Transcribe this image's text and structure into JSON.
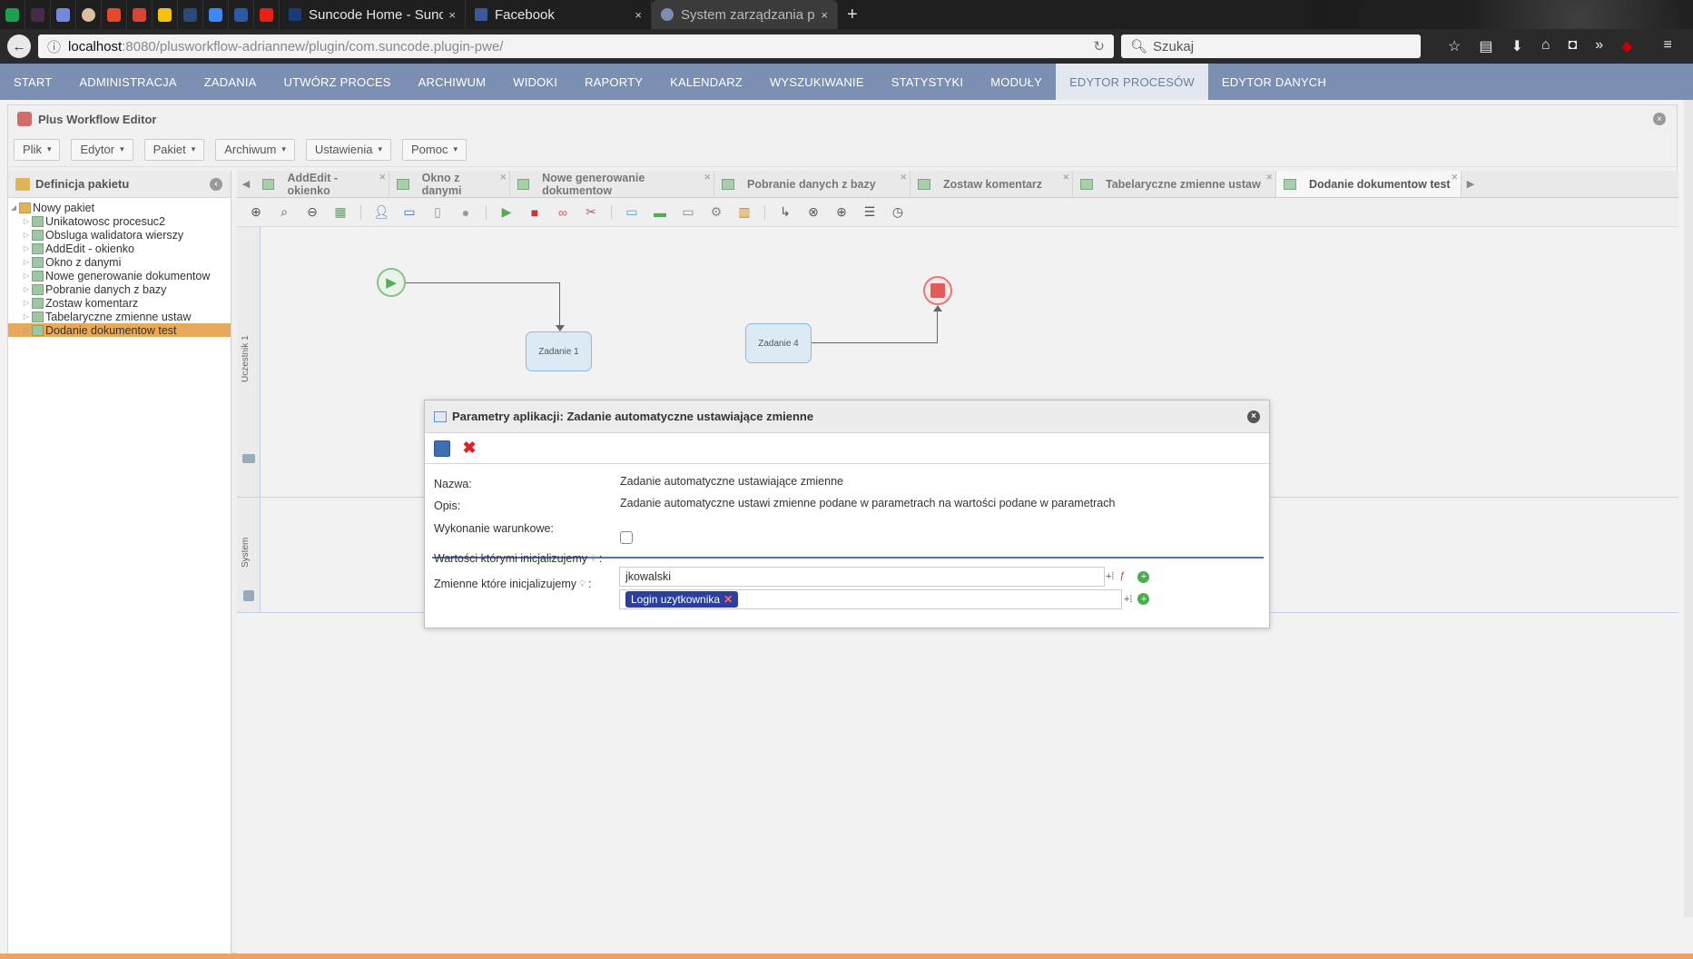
{
  "browser": {
    "pinned_tabs": [
      "sheets-icon",
      "hash-icon",
      "discord-icon",
      "avatar-icon",
      "gitlab-icon",
      "gmail-icon",
      "drive-icon",
      "x-icon",
      "docs-icon",
      "jira-icon",
      "youtube-icon"
    ],
    "tabs": [
      {
        "title": "Suncode Home - Sunco",
        "close": "×"
      },
      {
        "title": "Facebook",
        "close": "×"
      },
      {
        "title": "System zarządzania pr",
        "close": "×"
      }
    ],
    "new_tab": "+",
    "url_host": "localhost",
    "url_rest": ":8080/plusworkflow-adriannew/plugin/com.suncode.plugin-pwe/",
    "search_placeholder": "Szukaj"
  },
  "app_menu": [
    "START",
    "ADMINISTRACJA",
    "ZADANIA",
    "UTWÓRZ PROCES",
    "ARCHIWUM",
    "WIDOKI",
    "RAPORTY",
    "KALENDARZ",
    "WYSZUKIWANIE",
    "STATYSTYKI",
    "MODUŁY",
    "EDYTOR PROCESÓW",
    "EDYTOR DANYCH"
  ],
  "editor": {
    "title": "Plus Workflow Editor",
    "menus": [
      "Plik",
      "Edytor",
      "Pakiet",
      "Archiwum",
      "Ustawienia",
      "Pomoc"
    ],
    "left_title": "Definicja pakietu",
    "tree_root": "Nowy pakiet",
    "tree_items": [
      "Unikatowosc procesuc2",
      "Obsluga walidatora wierszy",
      "AddEdit - okienko",
      "Okno z danymi",
      "Nowe generowanie dokumentow",
      "Pobranie danych z bazy",
      "Zostaw komentarz",
      "Tabelaryczne zmienne ustaw",
      "Dodanie dokumentow test"
    ],
    "process_tabs": [
      "AddEdit - okienko",
      "Okno z danymi",
      "Nowe generowanie dokumentow",
      "Pobranie danych z bazy",
      "Zostaw komentarz",
      "Tabelaryczne zmienne ustaw",
      "Dodanie dokumentow test"
    ]
  },
  "canvas": {
    "lane1_label": "Uczestnik 1",
    "lane2_label": "System",
    "task1": "Zadanie 1",
    "task4": "Zadanie 4"
  },
  "modal": {
    "title": "Parametry aplikacji: Zadanie automatyczne ustawiające zmienne",
    "name_label": "Nazwa:",
    "name_value": "Zadanie automatyczne ustawiające zmienne",
    "desc_label": "Opis:",
    "desc_value": "Zadanie automatyczne ustawi zmienne podane w parametrach na wartości podane w parametrach",
    "cond_label": "Wykonanie warunkowe:",
    "values_label": "Wartości którymi inicjalizujemy",
    "values_input": "jkowalski",
    "vars_label": "Zmienne które inicjalizujemy",
    "vars_tag": "Login uzytkownika",
    "colon": ":"
  }
}
